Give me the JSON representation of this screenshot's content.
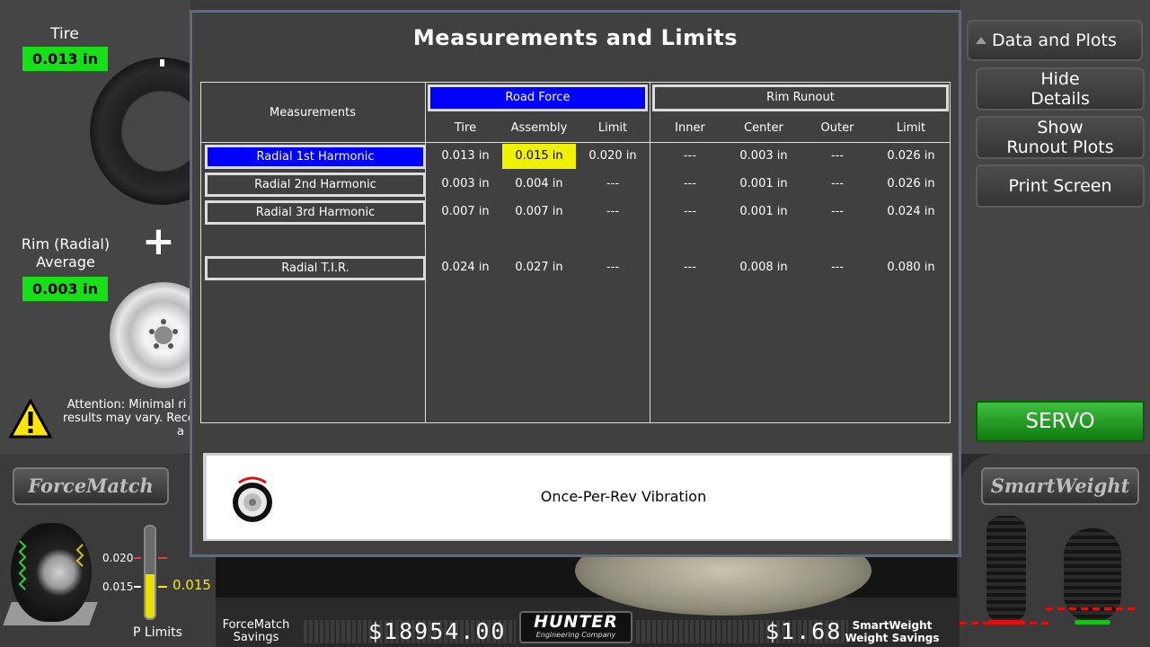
{
  "left_panel": {
    "tire_label": "Tire",
    "tire_value": "0.013 in",
    "rim_label_line1": "Rim (Radial)",
    "rim_label_line2": "Average",
    "rim_value": "0.003 in",
    "plus_symbol": "+",
    "attention_line1": "Attention: Minimal ri",
    "attention_line2": "results may vary. Reco",
    "attention_line3": "a",
    "forcematch_brand": "ForceMatch",
    "gauge": {
      "tick_high": "0.020",
      "tick_low": "0.015",
      "current": "0.015",
      "fill_fraction": 0.48,
      "limits_label": "P Limits"
    }
  },
  "right_panel": {
    "data_plots_label": "Data and Plots",
    "hide_details_line1": "Hide",
    "hide_details_line2": "Details",
    "show_runout_line1": "Show",
    "show_runout_line2": "Runout Plots",
    "print_screen_label": "Print Screen",
    "servo_label": "SERVO",
    "smartweight_brand": "SmartWeight"
  },
  "footer": {
    "forcematch_savings_line1": "ForceMatch",
    "forcematch_savings_line2": "Savings",
    "forcematch_amount": "$18954.00",
    "hunter_brand": "HUNTER",
    "hunter_sub": "Engineering Company",
    "smartweight_amount": "$1.68",
    "smartweight_savings_line1": "SmartWeight",
    "smartweight_savings_line2": "Weight Savings"
  },
  "modal": {
    "title": "Measurements and Limits",
    "measurements_header": "Measurements",
    "road_force_header": "Road Force",
    "rim_runout_header": "Rim Runout",
    "columns": [
      "Tire",
      "Assembly",
      "Limit",
      "Inner",
      "Center",
      "Outer",
      "Limit"
    ],
    "rows": [
      {
        "label": "Radial 1st Harmonic",
        "selected": true,
        "values": [
          "0.013 in",
          "0.015 in",
          "0.020 in",
          "---",
          "0.003 in",
          "---",
          "0.026 in"
        ]
      },
      {
        "label": "Radial 2nd Harmonic",
        "selected": false,
        "values": [
          "0.003 in",
          "0.004 in",
          "---",
          "---",
          "0.001 in",
          "---",
          "0.026 in"
        ]
      },
      {
        "label": "Radial 3rd Harmonic",
        "selected": false,
        "values": [
          "0.007 in",
          "0.007 in",
          "---",
          "---",
          "0.001 in",
          "---",
          "0.024 in"
        ]
      },
      {
        "label": "Radial T.I.R.",
        "selected": false,
        "values": [
          "0.024 in",
          "0.027 in",
          "---",
          "---",
          "0.008 in",
          "---",
          "0.080 in"
        ]
      }
    ],
    "vibration_label": "Once-Per-Rev Vibration"
  },
  "colors": {
    "selected_blue": "#0000ff",
    "highlight_yellow": "#f0f000",
    "value_green": "#18e018",
    "servo_green": "#1f9a1f"
  }
}
